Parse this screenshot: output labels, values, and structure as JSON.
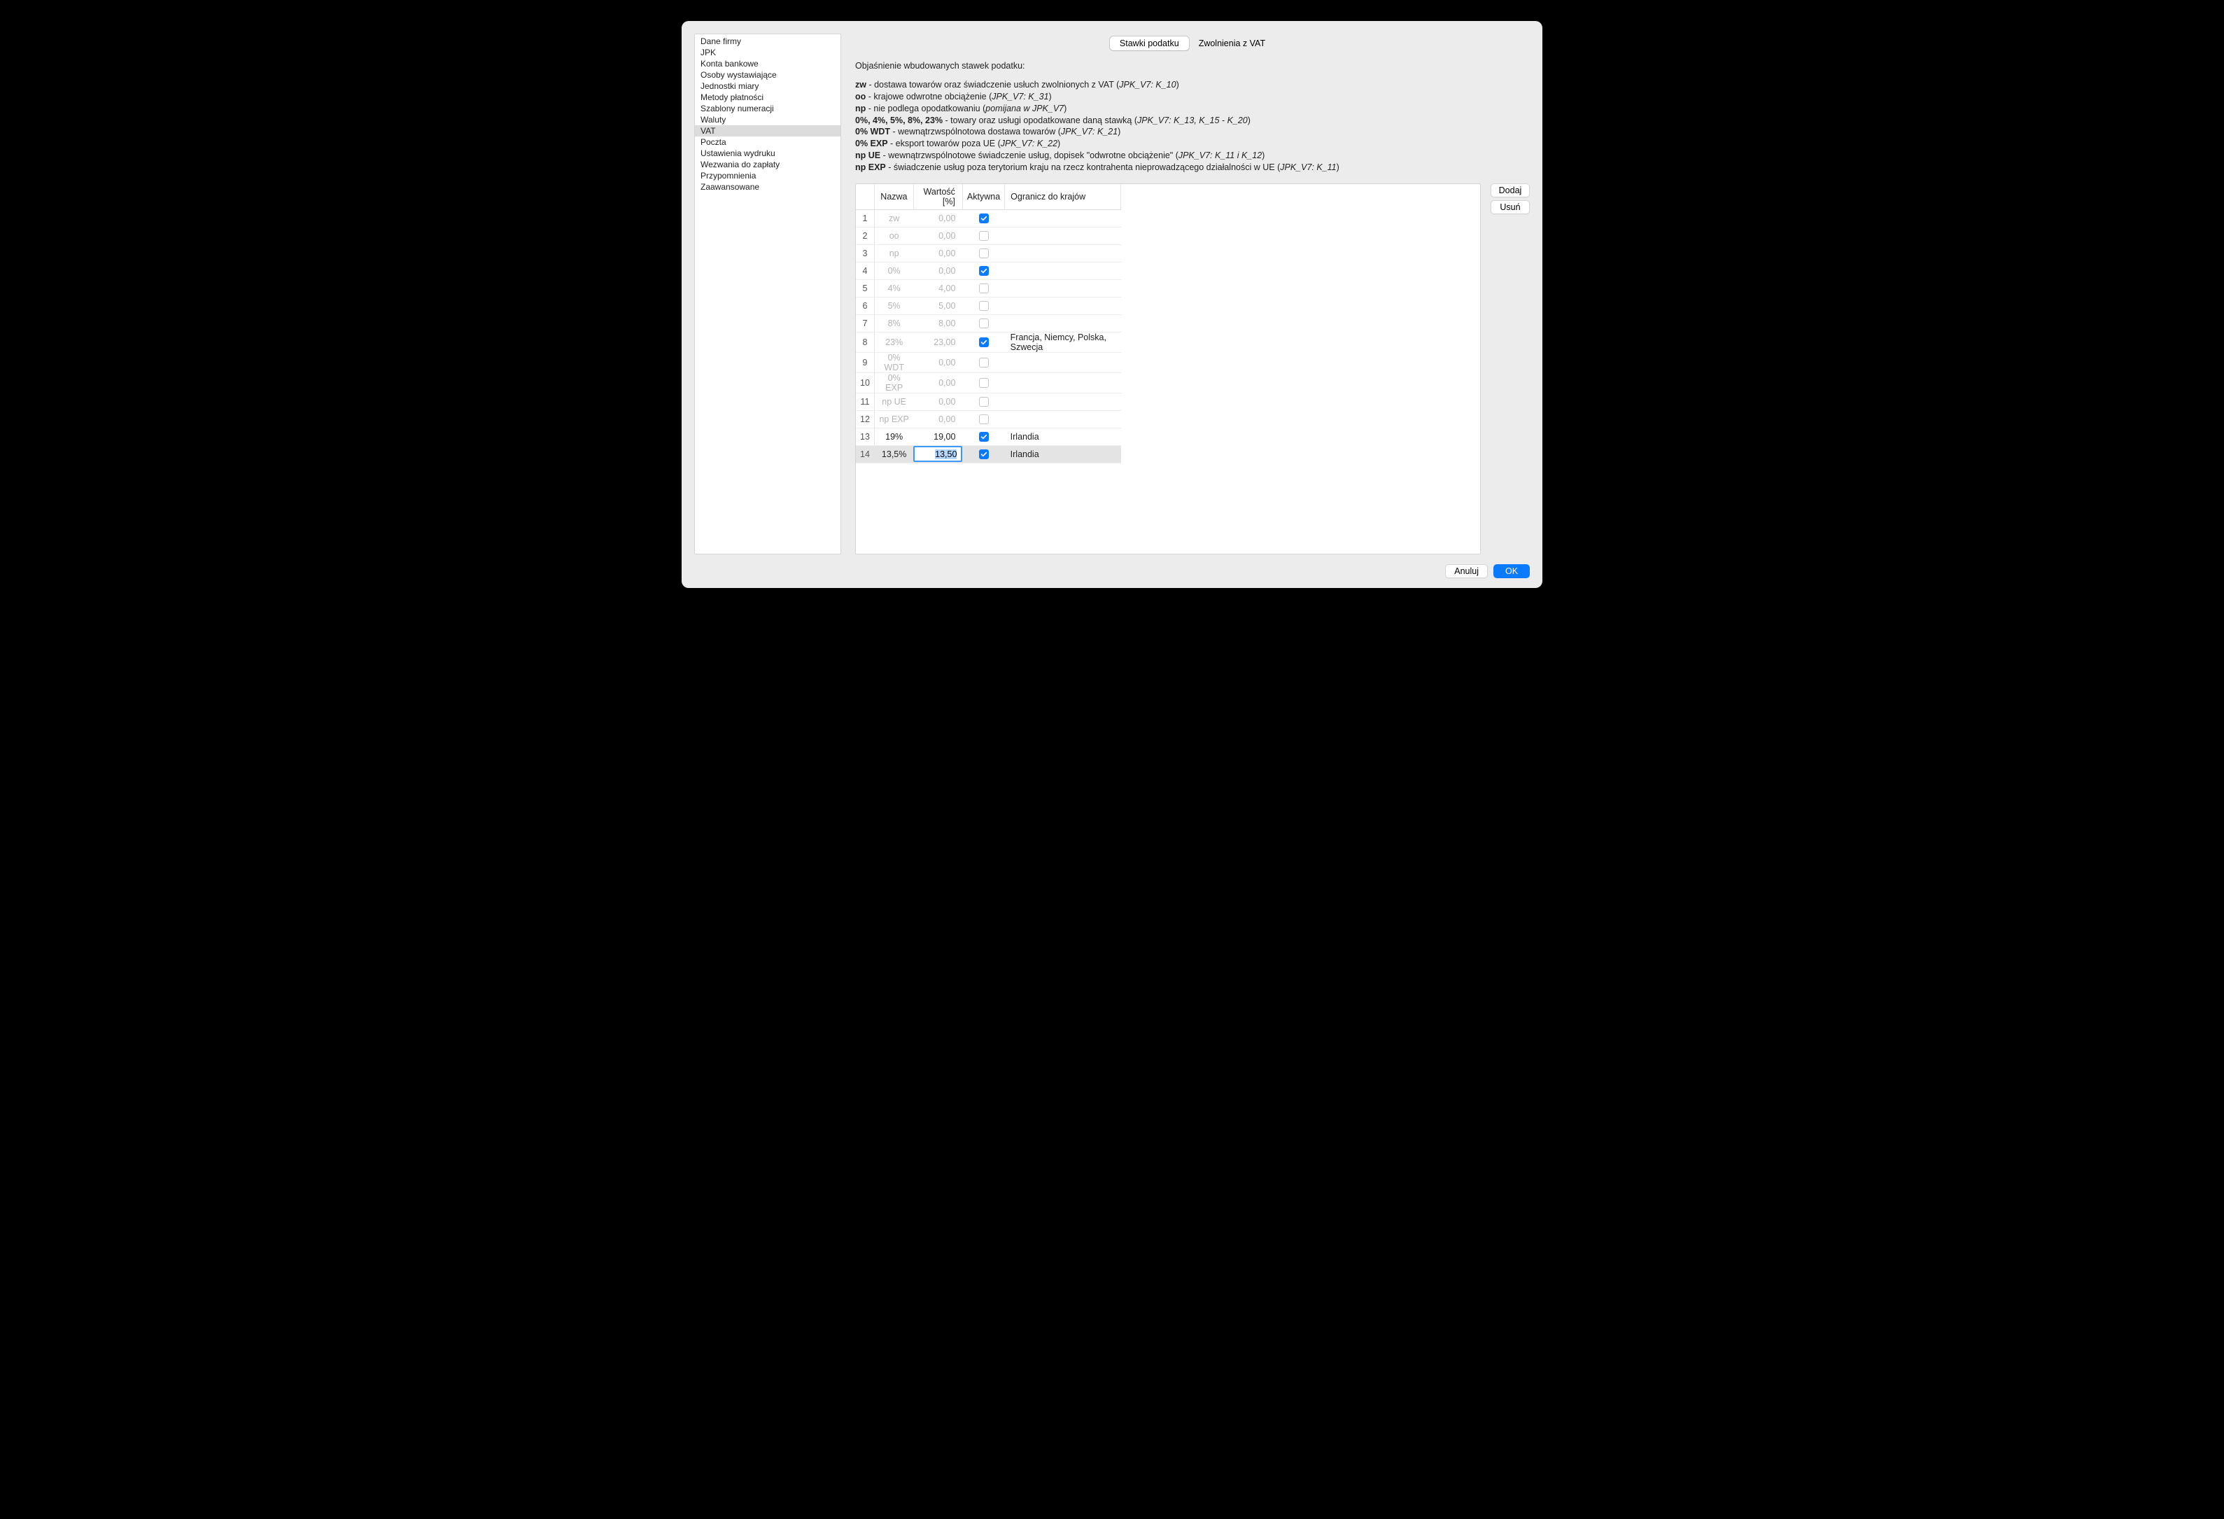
{
  "sidebar": {
    "items": [
      "Dane firmy",
      "JPK",
      "Konta bankowe",
      "Osoby wystawiające",
      "Jednostki miary",
      "Metody płatności",
      "Szablony numeracji",
      "Waluty",
      "VAT",
      "Poczta",
      "Ustawienia wydruku",
      "Wezwania do zapłaty",
      "Przypomnienia",
      "Zaawansowane"
    ],
    "selected_index": 8
  },
  "tabs": {
    "items": [
      "Stawki podatku",
      "Zwolnienia z VAT"
    ],
    "active_index": 0
  },
  "explain": {
    "intro": "Objaśnienie wbudowanych stawek podatku:",
    "lines": [
      {
        "b": "zw",
        "rest": " - dostawa towarów oraz świadczenie usłuch zwolnionych z VAT (",
        "i": "JPK_V7: K_10",
        "tail": ")"
      },
      {
        "b": "oo",
        "rest": " - krajowe odwrotne obciążenie (",
        "i": "JPK_V7: K_31",
        "tail": ")"
      },
      {
        "b": "np",
        "rest": " - nie podlega opodatkowaniu (",
        "i": "pomijana w JPK_V7",
        "tail": ")"
      },
      {
        "b": "0%, 4%, 5%, 8%, 23%",
        "rest": " - towary oraz usługi opodatkowane daną stawką (",
        "i": "JPK_V7: K_13, K_15 - K_20",
        "tail": ")"
      },
      {
        "b": "0% WDT",
        "rest": " - wewnątrzwspólnotowa dostawa towarów (",
        "i": "JPK_V7: K_21",
        "tail": ")"
      },
      {
        "b": "0% EXP",
        "rest": " - eksport towarów poza UE (",
        "i": "JPK_V7: K_22",
        "tail": ")"
      },
      {
        "b": "np UE",
        "rest": " - wewnątrzwspólnotowe świadczenie usług, dopisek \"odwrotne obciążenie\" (",
        "i": "JPK_V7: K_11 i K_12",
        "tail": ")"
      },
      {
        "b": "np EXP",
        "rest": " - świadczenie usług poza terytorium kraju na rzecz kontrahenta nieprowadzącego działalności w UE (",
        "i": "JPK_V7: K_11",
        "tail": ")"
      }
    ]
  },
  "table": {
    "headers": {
      "num": "",
      "name": "Nazwa",
      "value": "Wartość [%]",
      "active": "Aktywna",
      "countries": "Ogranicz do krajów"
    },
    "rows": [
      {
        "num": "1",
        "name": "zw",
        "value": "0,00",
        "active": true,
        "countries": "",
        "muted": true
      },
      {
        "num": "2",
        "name": "oo",
        "value": "0,00",
        "active": false,
        "countries": "",
        "muted": true
      },
      {
        "num": "3",
        "name": "np",
        "value": "0,00",
        "active": false,
        "countries": "",
        "muted": true
      },
      {
        "num": "4",
        "name": "0%",
        "value": "0,00",
        "active": true,
        "countries": "",
        "muted": true
      },
      {
        "num": "5",
        "name": "4%",
        "value": "4,00",
        "active": false,
        "countries": "",
        "muted": true
      },
      {
        "num": "6",
        "name": "5%",
        "value": "5,00",
        "active": false,
        "countries": "",
        "muted": true
      },
      {
        "num": "7",
        "name": "8%",
        "value": "8,00",
        "active": false,
        "countries": "",
        "muted": true
      },
      {
        "num": "8",
        "name": "23%",
        "value": "23,00",
        "active": true,
        "countries": "Francja, Niemcy, Polska, Szwecja",
        "muted": true
      },
      {
        "num": "9",
        "name": "0% WDT",
        "value": "0,00",
        "active": false,
        "countries": "",
        "muted": true
      },
      {
        "num": "10",
        "name": "0% EXP",
        "value": "0,00",
        "active": false,
        "countries": "",
        "muted": true
      },
      {
        "num": "11",
        "name": "np UE",
        "value": "0,00",
        "active": false,
        "countries": "",
        "muted": true
      },
      {
        "num": "12",
        "name": "np EXP",
        "value": "0,00",
        "active": false,
        "countries": "",
        "muted": true
      },
      {
        "num": "13",
        "name": "19%",
        "value": "19,00",
        "active": true,
        "countries": "Irlandia",
        "muted": false
      },
      {
        "num": "14",
        "name": "13,5%",
        "value": "13,50",
        "active": true,
        "countries": "Irlandia",
        "muted": false,
        "selected": true,
        "editing_value": true
      }
    ]
  },
  "side_buttons": {
    "add": "Dodaj",
    "remove": "Usuń"
  },
  "footer": {
    "cancel": "Anuluj",
    "ok": "OK"
  }
}
